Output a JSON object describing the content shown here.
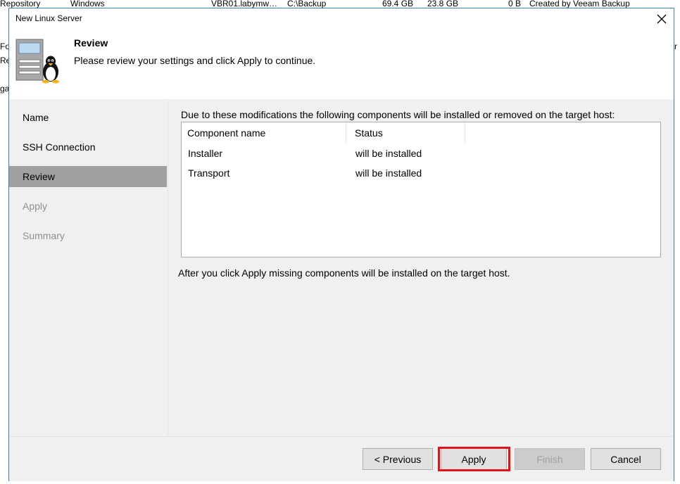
{
  "background_app": {
    "row": [
      "Repository",
      "Windows",
      "VBR01.labymw…",
      "C:\\Backup",
      "69.4 GB",
      "23.8 GB",
      "0 B",
      "Created by Veeam Backup"
    ],
    "fragments": [
      "Fo",
      "Re",
      "ga",
      "r"
    ]
  },
  "dialog": {
    "title": "New Linux Server",
    "close_glyph": "✕"
  },
  "header": {
    "icon": "linux-server-icon",
    "title": "Review",
    "subtitle": "Please review your settings and click Apply to continue."
  },
  "sidebar": {
    "items": [
      {
        "label": "Name",
        "state": "normal"
      },
      {
        "label": "SSH Connection",
        "state": "normal"
      },
      {
        "label": "Review",
        "state": "active"
      },
      {
        "label": "Apply",
        "state": "disabled"
      },
      {
        "label": "Summary",
        "state": "disabled"
      }
    ]
  },
  "content": {
    "intro": "Due to these modifications the following components will be installed or removed on the target host:",
    "columns": [
      "Component name",
      "Status"
    ],
    "rows": [
      {
        "component": "Installer",
        "status": "will be installed"
      },
      {
        "component": "Transport",
        "status": "will be installed"
      }
    ],
    "footer": "After you click Apply missing components will be installed on the target host."
  },
  "buttons": {
    "previous": "< Previous",
    "apply": "Apply",
    "finish": "Finish",
    "cancel": "Cancel"
  },
  "colors": {
    "accent_border": "#3c7fb1",
    "active_nav": "#a0a0a0",
    "highlight": "#e0151a"
  }
}
